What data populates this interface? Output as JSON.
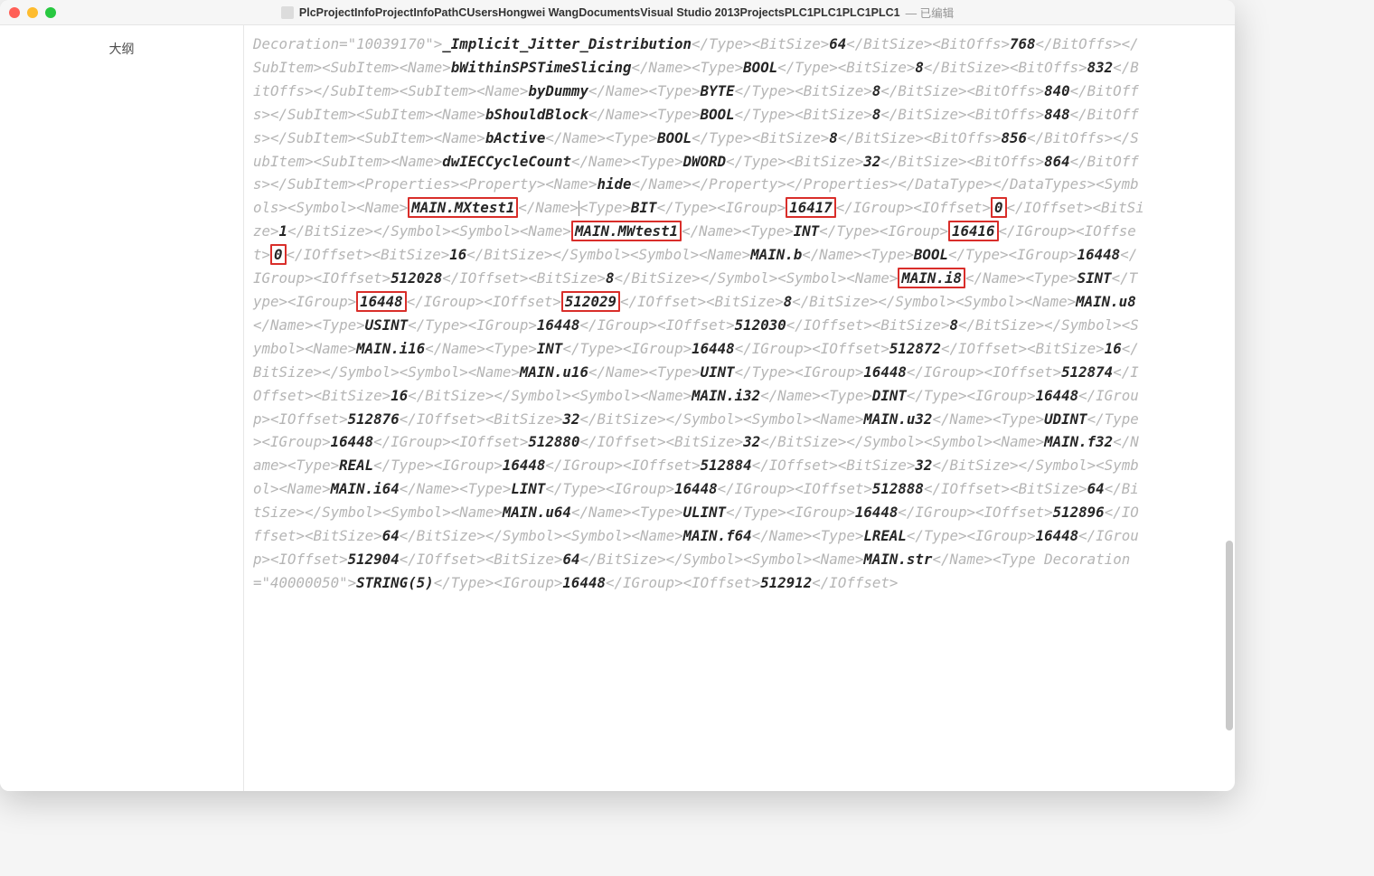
{
  "titlebar": {
    "filename": "PlcProjectInfoProjectInfoPathCUsersHongwei WangDocumentsVisual Studio 2013ProjectsPLC1PLC1PLC1PLC1",
    "status": "— 已编辑"
  },
  "sidebar": {
    "outline_label": "大纲"
  },
  "frag": {
    "dec_attr": "Decoration=\"10039170\">",
    "ijd": "_Implicit_Jitter_Distribution",
    "t_type_c": "</Type>",
    "t_bitsize_o": "<BitSize>",
    "t_bitsize_c": "</BitSize>",
    "t_bitoffs_o": "<BitOffs>",
    "t_bitoffs_c": "</BitOffs>",
    "t_subitem_o": "<SubItem>",
    "t_subitem_c": "</SubItem>",
    "t_name_o": "<Name>",
    "t_name_c": "</Name>",
    "t_type_o": "<Type>",
    "t_igroup_o": "<IGroup>",
    "t_igroup_c": "</IGroup>",
    "t_ioffset_o": "<IOffset>",
    "t_ioffset_c": "</IOffset>",
    "t_symbol_o": "<Symbol>",
    "t_symbol_c": "</Symbol>",
    "t_props_c": "</Properties>",
    "t_prop_c": "</Property>",
    "t_props_o": "<Properties>",
    "t_prop_o": "<Property>",
    "t_datatype_c": "</DataType>",
    "t_datatypes_c": "</DataTypes>",
    "t_symbols_o": "<Symbols>",
    "t_typedec_o": "<Type ",
    "v64": "64",
    "v768": "768",
    "bWithin": "bWithinSPSTimeSlicing",
    "BOOL": "BOOL",
    "v8": "8",
    "v832": "832",
    "byDummy": "byDummy",
    "BYTE": "BYTE",
    "v840": "840",
    "bShouldBlock": "bShouldBlock",
    "v848": "848",
    "bActive": "bActive",
    "v856": "856",
    "dwIEC": "dwIECCycleCount",
    "DWORD": "DWORD",
    "v32": "32",
    "v864": "864",
    "hide": "hide",
    "MXtest1": "MAIN.MXtest1",
    "BIT": "BIT",
    "v16417": "16417",
    "v0": "0",
    "v1": "1",
    "MWtest1": "MAIN.MWtest1",
    "INT": "INT",
    "v16416": "16416",
    "v16": "16",
    "MAINb": "MAIN.b",
    "v16448": "16448",
    "v512028": "512028",
    "MAINi8": "MAIN.i8",
    "SINT": "SINT",
    "v512029": "512029",
    "MAINu8": "MAIN.u8",
    "USINT": "USINT",
    "v512030": "512030",
    "MAINi16": "MAIN.i16",
    "v512872": "512872",
    "MAINu16": "MAIN.u16",
    "UINT": "UINT",
    "v512874": "512874",
    "MAINi32": "MAIN.i32",
    "DINT": "DINT",
    "v512876": "512876",
    "MAINu32": "MAIN.u32",
    "UDINT": "UDINT",
    "v512880": "512880",
    "MAINf32": "MAIN.f32",
    "REAL": "REAL",
    "v512884": "512884",
    "MAINi64": "MAIN.i64",
    "LINT": "LINT",
    "v512888": "512888",
    "MAINu64": "MAIN.u64",
    "ULINT": "ULINT",
    "v512896": "512896",
    "MAINf64": "MAIN.f64",
    "LREAL": "LREAL",
    "v512904": "512904",
    "MAINstr": "MAIN.str",
    "dec2": "Decoration=\"40000050\">",
    "STRING5": "STRING(5)",
    "v512912": "512912"
  },
  "highlights": [
    "MAIN.MXtest1",
    "16417",
    "0",
    "MAIN.MWtest1",
    "16416",
    "0",
    "MAIN.i8",
    "16448",
    "512029"
  ]
}
